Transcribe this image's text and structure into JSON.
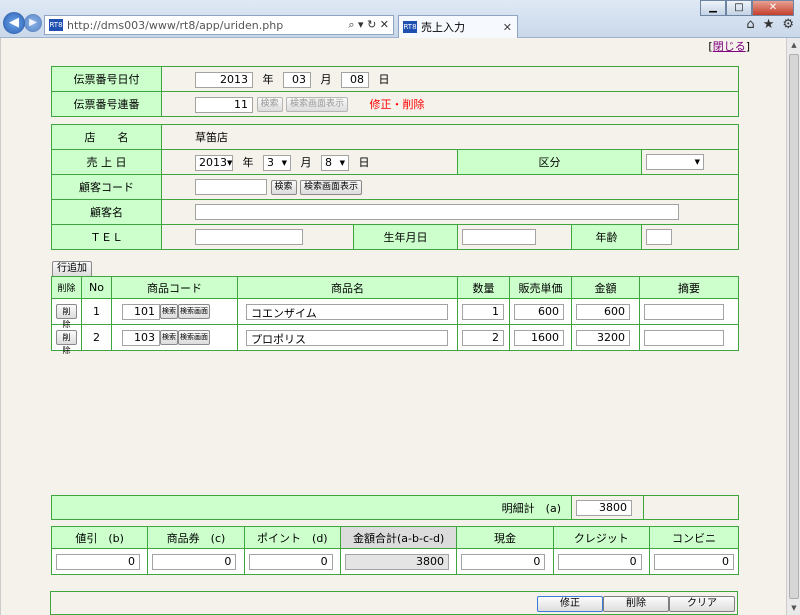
{
  "browser": {
    "url": "http://dms003/www/rt8/app/uriden.php",
    "url_tools": "⌕ ▾ ↻ ✕",
    "tab_title": "売上入力",
    "favicon_text": "RT8",
    "window_min": "▁",
    "window_max": "□",
    "window_close": "✕",
    "tab_close": "✕"
  },
  "close_link": "閉じる",
  "slip": {
    "date_label": "伝票番号日付",
    "year": "2013",
    "year_unit": "年",
    "month": "03",
    "month_unit": "月",
    "day": "08",
    "day_unit": "日",
    "serial_label": "伝票番号連番",
    "serial": "11",
    "search_btn": "検索",
    "search_screen_btn": "検索画面表示",
    "edit_delete": "修正・削除"
  },
  "header": {
    "store_label": "店　　名",
    "store_value": "草笛店",
    "sales_date_label": "売 上 日",
    "sales_year": "2013",
    "year_unit": "年",
    "sales_month": "3",
    "month_unit": "月",
    "sales_day": "8",
    "day_unit": "日",
    "category_label": "区分",
    "category_value": "",
    "customer_code_label": "顧客コード",
    "customer_code": "",
    "search_btn": "検索",
    "search_screen_btn": "検索画面表示",
    "customer_name_label": "顧客名",
    "customer_name": "",
    "tel_label": "ＴＥＬ",
    "tel": "",
    "birth_label": "生年月日",
    "birth": "",
    "age_label": "年齢",
    "age": ""
  },
  "add_row_btn": "行追加",
  "items": {
    "headers": [
      "削除",
      "No",
      "商品コード",
      "商品名",
      "数量",
      "販売単価",
      "金額",
      "摘要"
    ],
    "delete_btn": "削除",
    "search_btn": "検索",
    "search_screen_btn": "検索画面",
    "rows": [
      {
        "no": "1",
        "code": "101",
        "name": "コエンザイム",
        "qty": "1",
        "price": "600",
        "amount": "600",
        "note": ""
      },
      {
        "no": "2",
        "code": "103",
        "name": "プロポリス",
        "qty": "2",
        "price": "1600",
        "amount": "3200",
        "note": ""
      }
    ]
  },
  "subtotal": {
    "label": "明細計　(a)",
    "value": "3800"
  },
  "totals": {
    "headers": [
      "値引　(b)",
      "商品券　(c)",
      "ポイント　(d)",
      "金額合計(a-b-c-d)",
      "現金",
      "クレジット",
      "コンビニ"
    ],
    "values": [
      "0",
      "0",
      "0",
      "3800",
      "0",
      "0",
      "0"
    ]
  },
  "actions": {
    "edit": "修正",
    "delete": "削除",
    "clear": "クリア"
  }
}
